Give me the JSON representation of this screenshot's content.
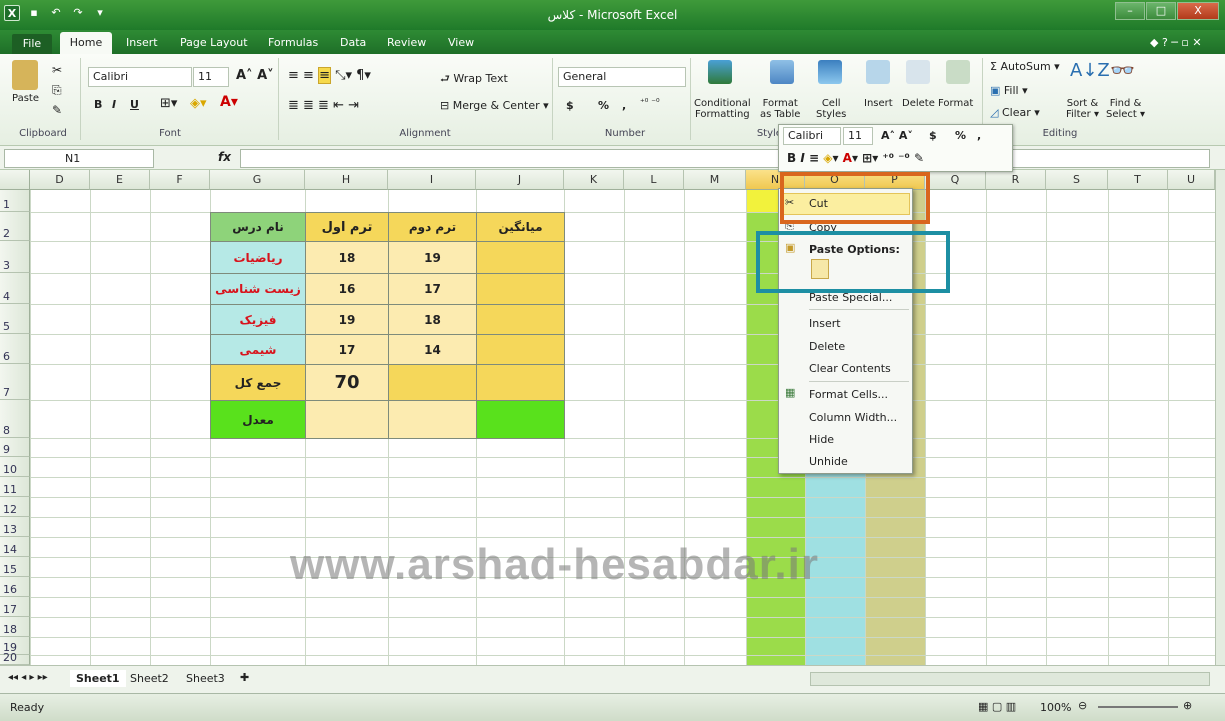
{
  "window": {
    "title": "کلاس - Microsoft Excel",
    "btn_min": "–",
    "btn_max": "□",
    "btn_close": "X"
  },
  "tabs": [
    "File",
    "Home",
    "Insert",
    "Page Layout",
    "Formulas",
    "Data",
    "Review",
    "View"
  ],
  "ribbon": {
    "clipboard": {
      "paste": "Paste",
      "label": "Clipboard"
    },
    "font": {
      "name": "Calibri",
      "size": "11",
      "label": "Font",
      "bold": "B",
      "italic": "I",
      "underline": "U"
    },
    "alignment": {
      "wrap": "Wrap Text",
      "merge": "Merge & Center",
      "label": "Alignment"
    },
    "number": {
      "format": "General",
      "currency": "$",
      "percent": "%",
      "comma": ",",
      "label": "Number"
    },
    "styles": {
      "cond": "Conditional",
      "cond2": "Formatting",
      "fmt_table": "Format",
      "fmt_table2": "as Table",
      "cell_styles": "Cell",
      "cell_styles2": "Styles",
      "label": "Styles"
    },
    "cells": {
      "insert": "Insert",
      "delete": "Delete",
      "format": "Format"
    },
    "editing": {
      "autosum": "AutoSum",
      "fill": "Fill",
      "clear": "Clear",
      "sort": "Sort &",
      "sort2": "Filter",
      "find": "Find &",
      "find2": "Select",
      "label": "Editing"
    }
  },
  "formula_bar": {
    "name_box": "N1",
    "fx": "fx"
  },
  "columns": [
    "D",
    "E",
    "F",
    "G",
    "H",
    "I",
    "J",
    "K",
    "L",
    "M",
    "N",
    "O",
    "P",
    "Q",
    "R",
    "S",
    "T",
    "U"
  ],
  "rows": [
    "1",
    "2",
    "3",
    "4",
    "5",
    "6",
    "7",
    "8",
    "9",
    "10",
    "11",
    "12",
    "13",
    "14",
    "15",
    "16",
    "17",
    "18",
    "19",
    "20"
  ],
  "table": {
    "headers": [
      "نام درس",
      "ترم اول",
      "ترم دوم",
      "میانگین"
    ],
    "subjects": [
      "ریاضیات",
      "زیست شناسی",
      "فیزیک",
      "شیمی"
    ],
    "term1": [
      "18",
      "16",
      "19",
      "17"
    ],
    "term2": [
      "19",
      "17",
      "18",
      "14"
    ],
    "total_label": "جمع کل",
    "total_value": "70",
    "avg_label": "معدل"
  },
  "minibar": {
    "font": "Calibri",
    "size": "11",
    "currency": "$",
    "percent": "%",
    "comma": ","
  },
  "context_menu": {
    "cut": "Cut",
    "copy": "Copy",
    "paste_options": "Paste Options:",
    "paste_special": "Paste Special...",
    "insert": "Insert",
    "delete": "Delete",
    "clear": "Clear Contents",
    "format_cells": "Format Cells...",
    "col_width": "Column Width...",
    "hide": "Hide",
    "unhide": "Unhide"
  },
  "sheets": [
    "Sheet1",
    "Sheet2",
    "Sheet3"
  ],
  "status": {
    "ready": "Ready",
    "zoom": "100%"
  },
  "watermark": "www.arshad-hesabdar.ir",
  "colors": {
    "header_green": "#8ed37a",
    "subject_cyan": "#b6e9e6",
    "gold": "#f5d75a",
    "light_yellow": "#fcebb0",
    "lime": "#59e11c",
    "col_n": "#9bdc4a",
    "col_o": "#9fe0e2",
    "col_p": "#cfcf8c",
    "highlight_orange": "#d9661d",
    "highlight_teal": "#1d8fa3"
  }
}
